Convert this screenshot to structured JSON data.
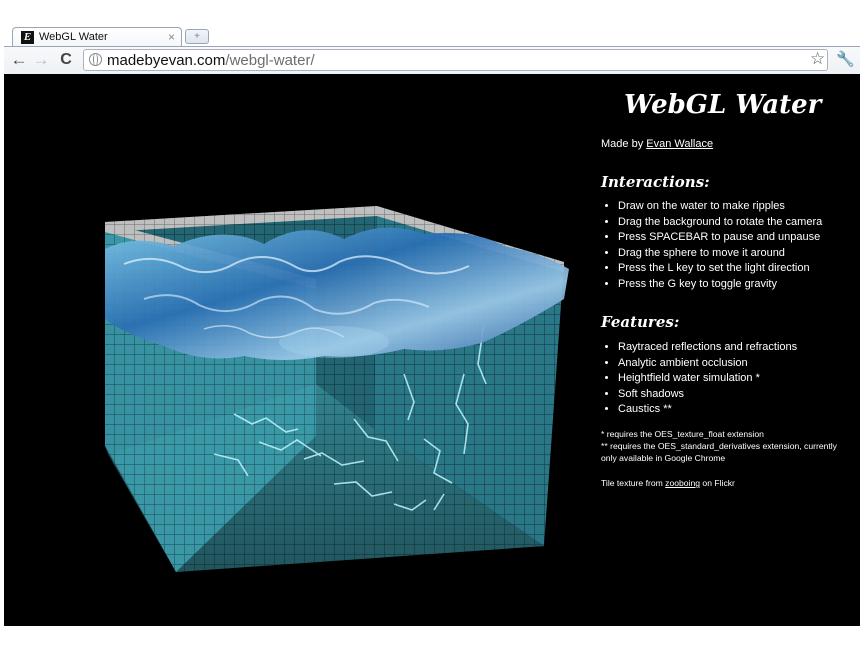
{
  "tab": {
    "title": "WebGL Water",
    "favicon": "E",
    "close": "×",
    "newtab": "+"
  },
  "toolbar": {
    "back": "←",
    "forward": "→",
    "reload": "C",
    "star": "☆",
    "wrench": "🔧"
  },
  "address": {
    "host": "madebyevan.com",
    "path": "/webgl-water/"
  },
  "page": {
    "title": "WebGL Water",
    "madeby_prefix": "Made by ",
    "author": "Evan Wallace",
    "interactions_heading": "Interactions:",
    "interactions": [
      "Draw on the water to make ripples",
      "Drag the background to rotate the camera",
      "Press SPACEBAR to pause and unpause",
      "Drag the sphere to move it around",
      "Press the L key to set the light direction",
      "Press the G key to toggle gravity"
    ],
    "features_heading": "Features:",
    "features": [
      "Raytraced reflections and refractions",
      "Analytic ambient occlusion",
      "Heightfield water simulation *",
      "Soft shadows",
      "Caustics **"
    ],
    "footnote1": "* requires the OES_texture_float extension",
    "footnote2": "** requires the OES_standard_derivatives extension, currently only available in Google Chrome",
    "credit_prefix": "Tile texture from ",
    "credit_link": "zooboing",
    "credit_suffix": " on Flickr"
  },
  "colors": {
    "background": "#000000",
    "water": "#3fa6c2",
    "tile_grout": "#1e5661",
    "text": "#ffffff"
  }
}
